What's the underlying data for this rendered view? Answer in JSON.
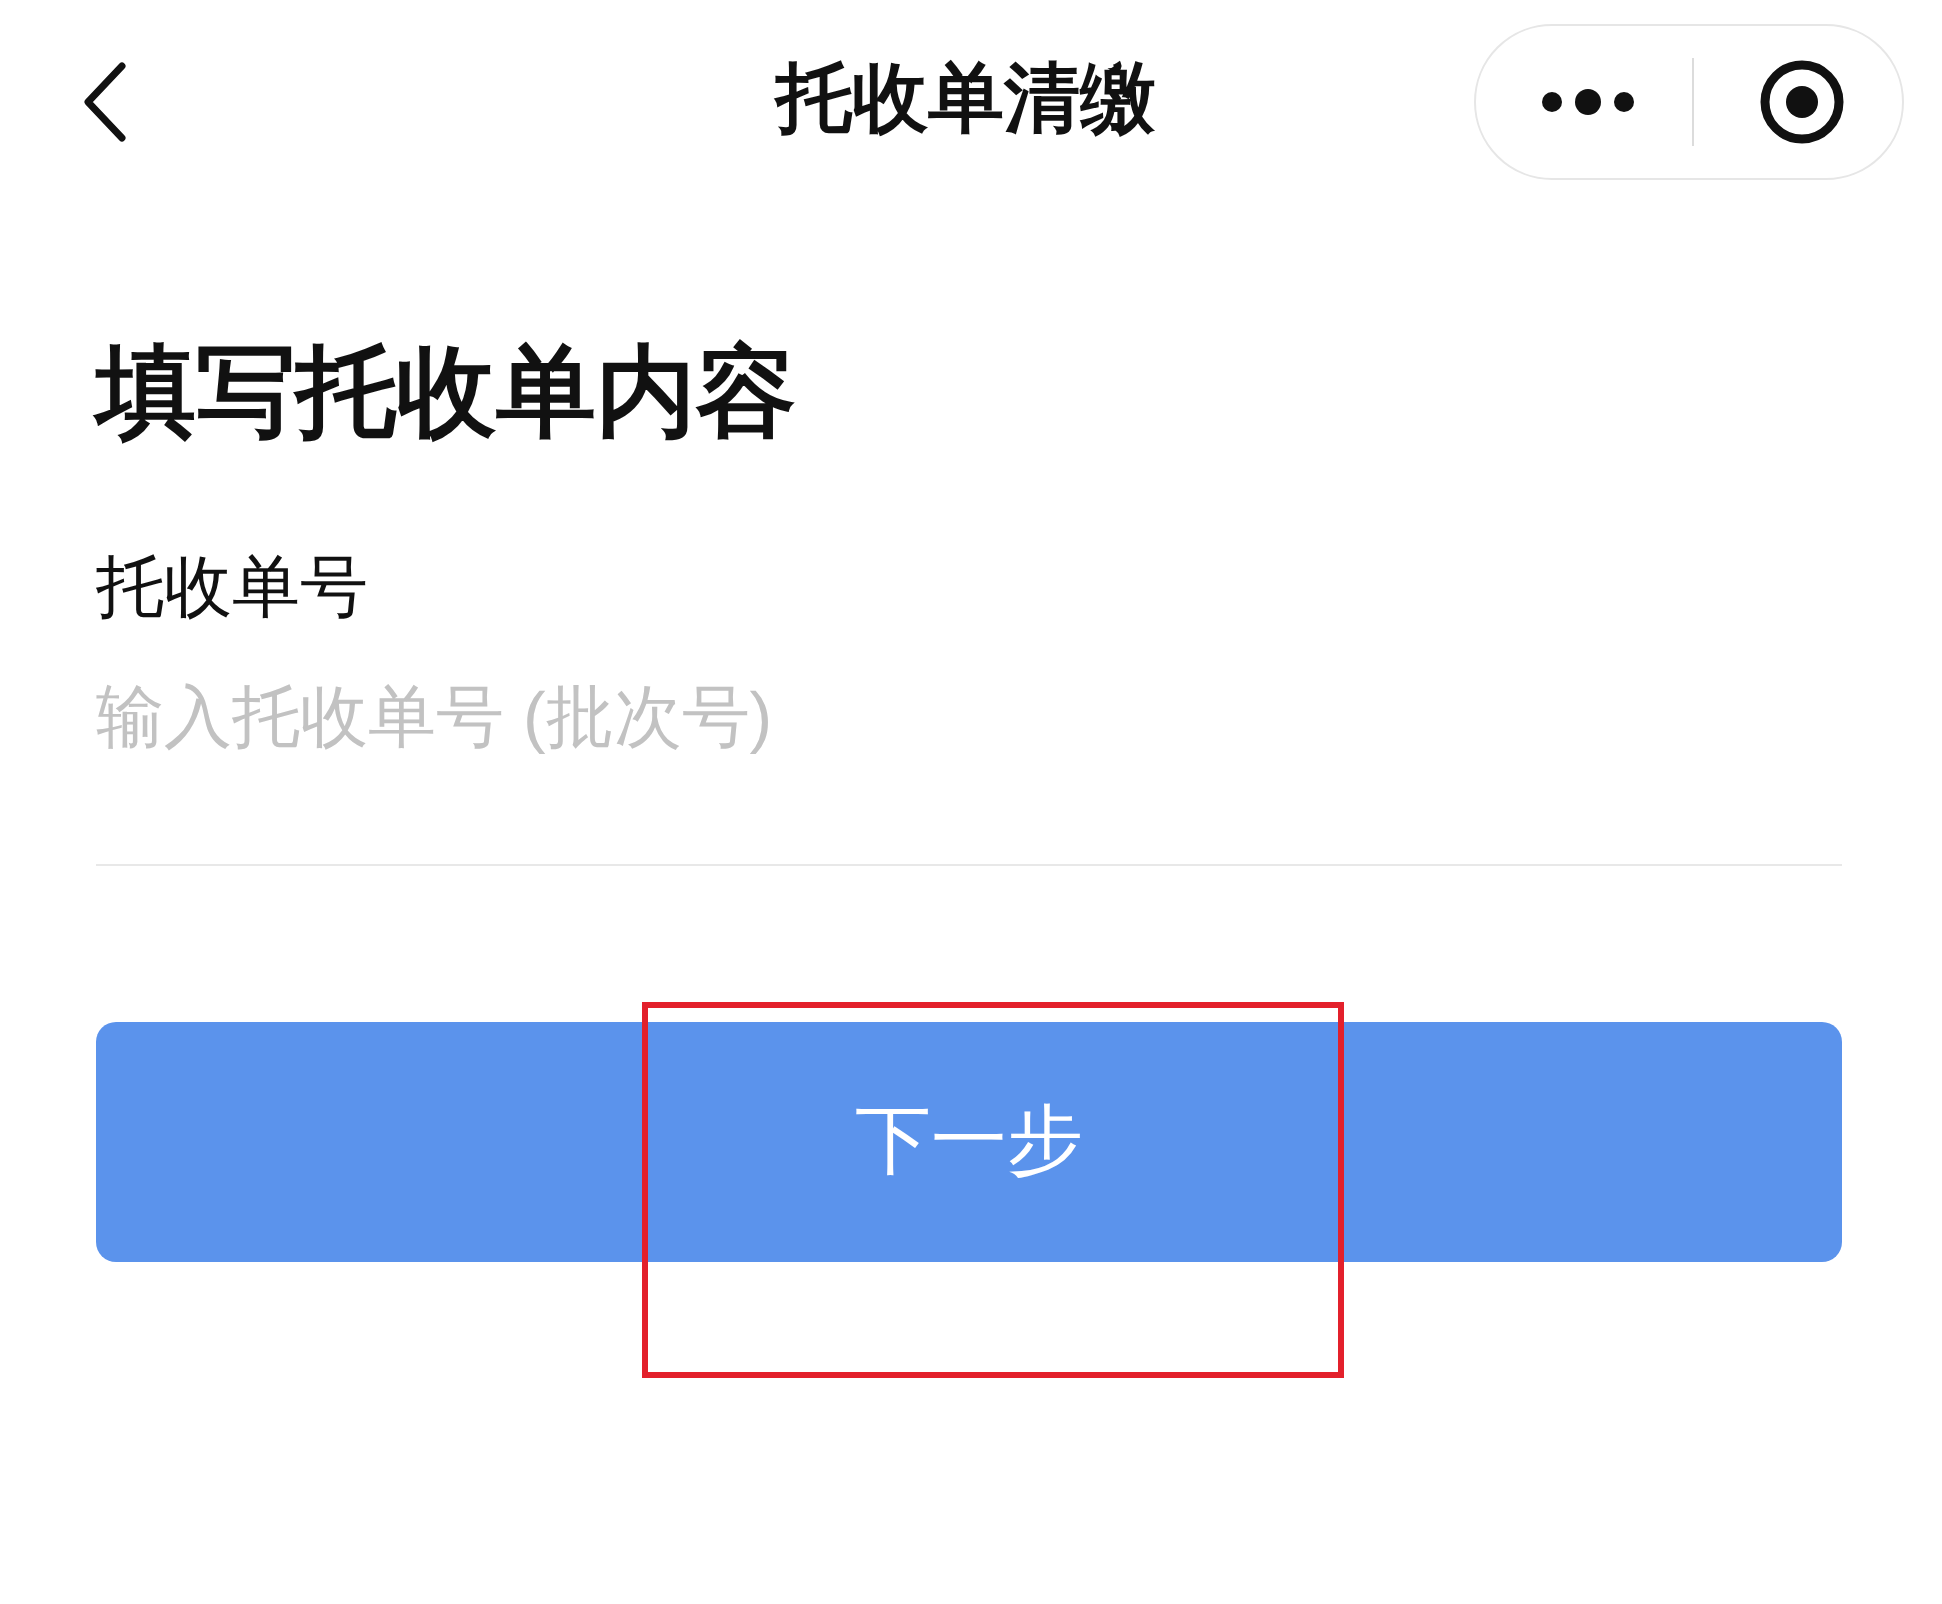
{
  "nav_bar": {
    "title": "托收单清缴"
  },
  "heading": "填写托收单内容",
  "field": {
    "label": "托收单号",
    "placeholder": "输入托收单号 (批次号)"
  },
  "next_button": {
    "label": "下一步"
  },
  "annotations": [
    {
      "kind": "highlight-frame"
    }
  ]
}
